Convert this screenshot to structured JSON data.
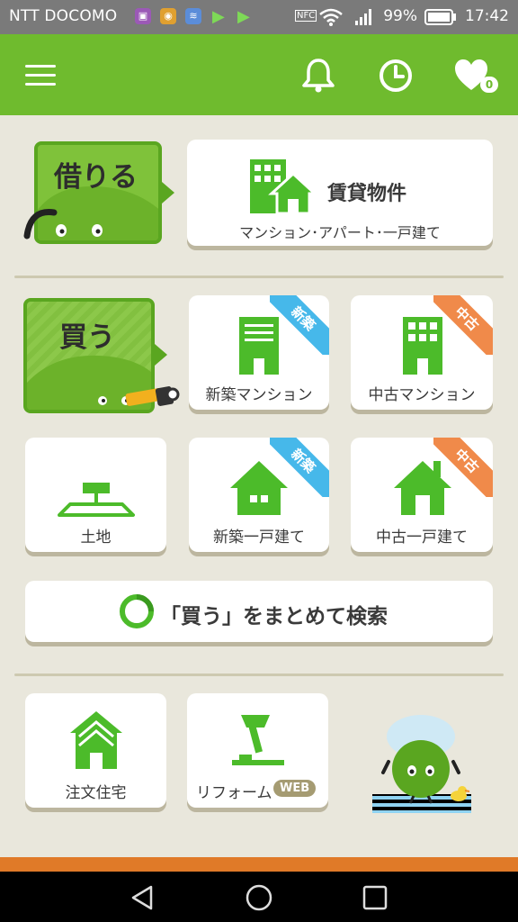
{
  "status_bar": {
    "carrier": "NTT DOCOMO",
    "battery_percent": "99%",
    "time": "17:42"
  },
  "header": {
    "favorites_count": "0"
  },
  "rent": {
    "tag_label": "借りる",
    "card_title": "賃貸物件",
    "card_subtitle": "マンション･アパート･一戸建て"
  },
  "buy": {
    "tag_label": "買う",
    "items": [
      {
        "label": "新築マンション",
        "ribbon": "新築"
      },
      {
        "label": "中古マンション",
        "ribbon": "中古"
      },
      {
        "label": "土地",
        "ribbon": ""
      },
      {
        "label": "新築一戸建て",
        "ribbon": "新築"
      },
      {
        "label": "中古一戸建て",
        "ribbon": "中古"
      }
    ],
    "search_all_label": "「買う」をまとめて検索"
  },
  "other": {
    "custom_home_label": "注文住宅",
    "reform_label": "リフォーム",
    "reform_badge": "WEB"
  },
  "colors": {
    "brand_green": "#6fbb2e",
    "new_blue": "#46b8ea",
    "used_orange": "#f08a4a"
  }
}
